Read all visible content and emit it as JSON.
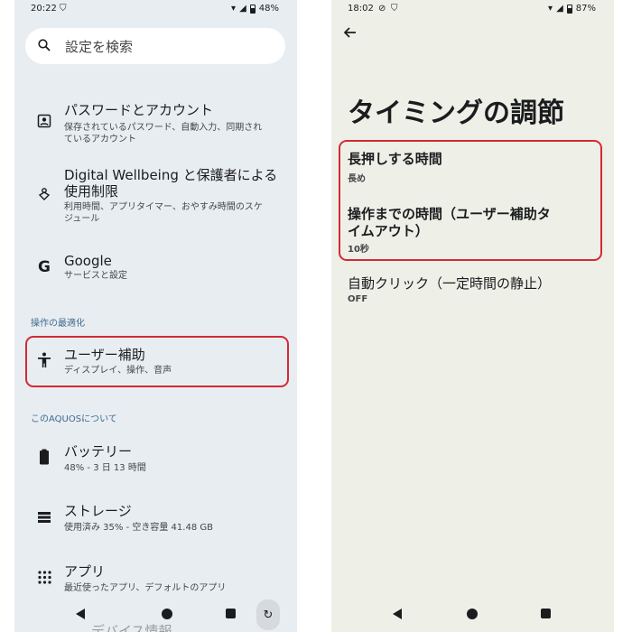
{
  "left": {
    "status": {
      "time": "20:22",
      "battery": "48%"
    },
    "search": {
      "placeholder": "設定を検索"
    },
    "items": [
      {
        "icon": "account-box-icon",
        "title": "パスワードとアカウント",
        "subtitle": "保存されているパスワード、自動入力、同期されているアカウント"
      },
      {
        "icon": "wellbeing-icon",
        "title": "Digital Wellbeing と保護者による使用制限",
        "subtitle": "利用時間、アプリタイマー、おやすみ時間のスケジュール"
      },
      {
        "icon": "google-icon",
        "title": "Google",
        "subtitle": "サービスと設定"
      }
    ],
    "section1": "操作の最適化",
    "accessibility": {
      "icon": "accessibility-icon",
      "title": "ユーザー補助",
      "subtitle": "ディスプレイ、操作、音声"
    },
    "section2": "このAQUOSについて",
    "items2": [
      {
        "icon": "battery-icon",
        "title": "バッテリー",
        "subtitle": "48% - 3 日 13 時間"
      },
      {
        "icon": "storage-icon",
        "title": "ストレージ",
        "subtitle": "使用済み 35% - 空き容量 41.48 GB"
      },
      {
        "icon": "apps-icon",
        "title": "アプリ",
        "subtitle": "最近使ったアプリ、デフォルトのアプリ"
      }
    ],
    "partial": "デバイス情報"
  },
  "right": {
    "status": {
      "time": "18:02",
      "battery": "87%"
    },
    "title": "タイミングの調節",
    "items": [
      {
        "title": "長押しする時間",
        "value": "長め"
      },
      {
        "title": "操作までの時間（ユーザー補助タイムアウト）",
        "value": "10秒"
      },
      {
        "title": "自動クリック（一定時間の静止）",
        "value": "OFF"
      }
    ]
  },
  "colors": {
    "highlight": "#d32a34",
    "left_bg": "#e8edf2",
    "right_bg": "#eeefe7",
    "section": "#3e6a8c"
  }
}
